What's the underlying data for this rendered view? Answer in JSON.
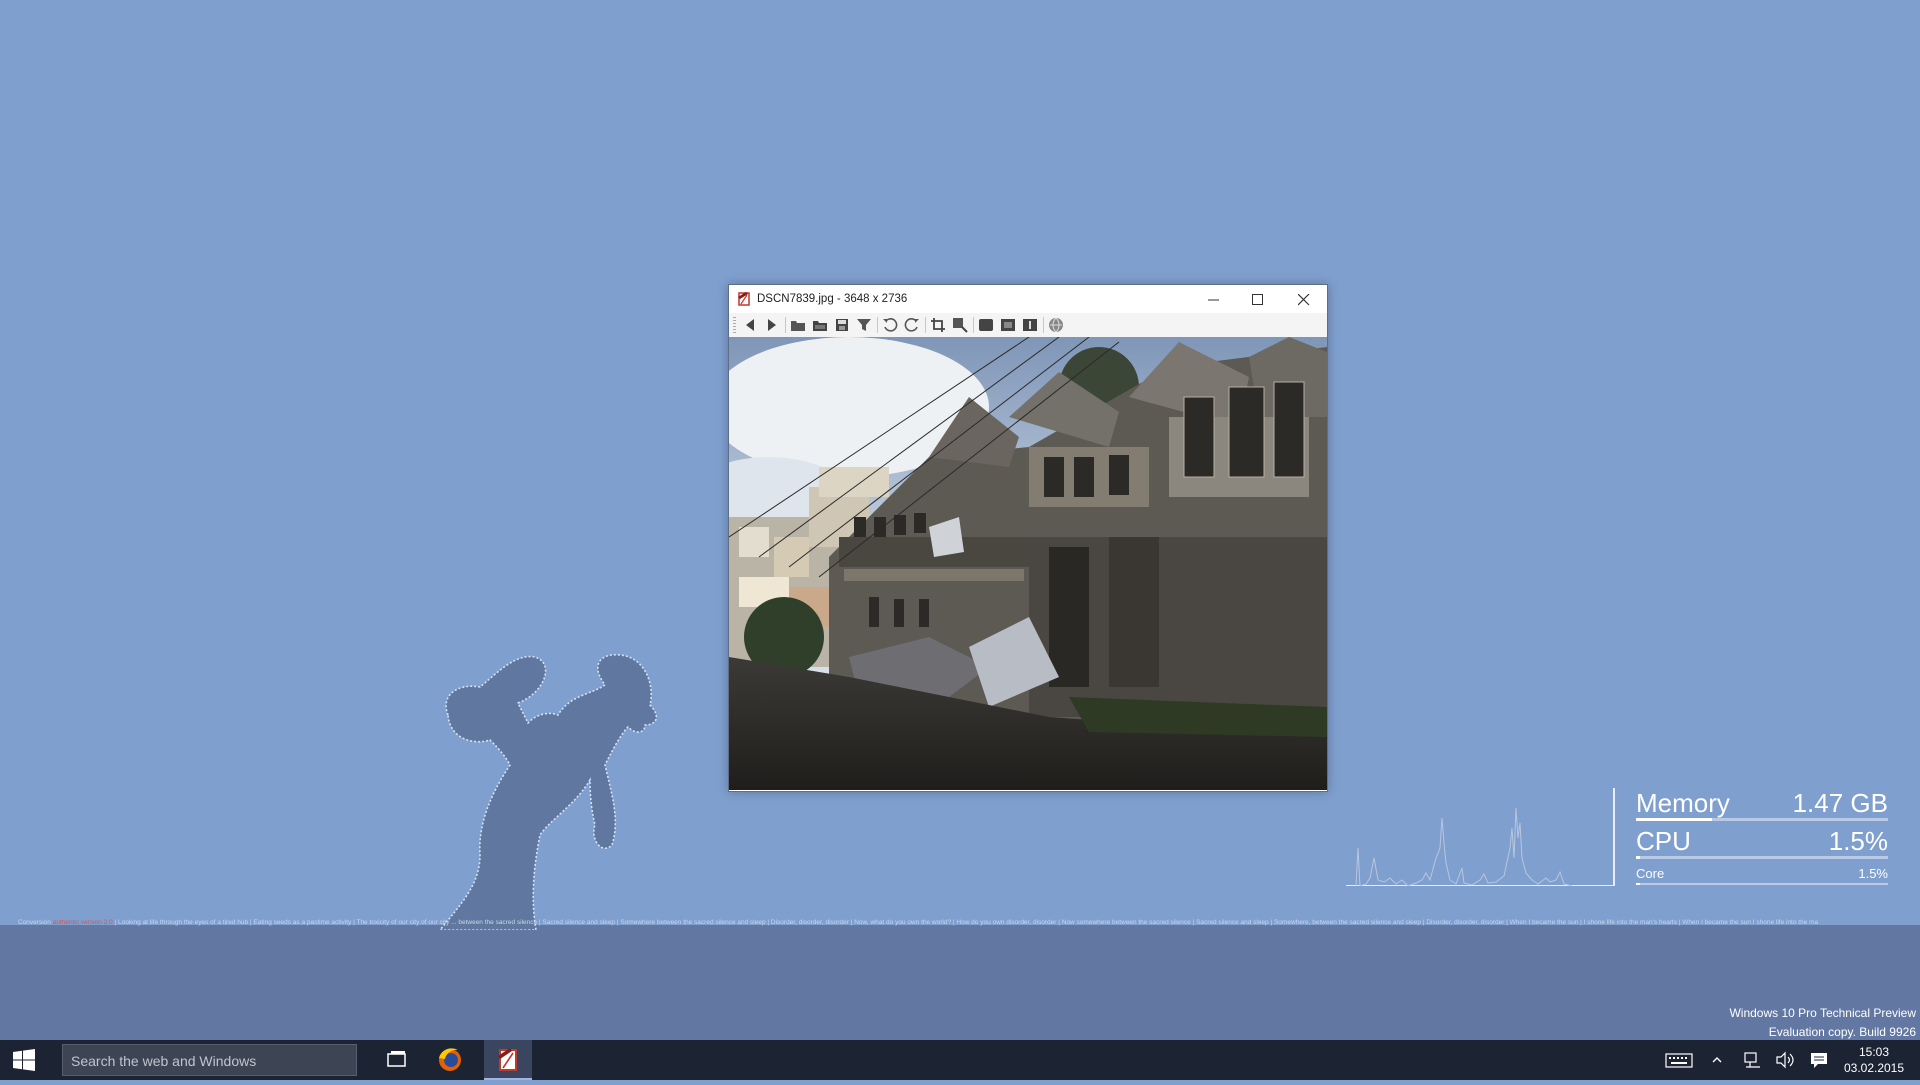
{
  "colors": {
    "desktop": "#7f9fcf",
    "band": "#6277a1",
    "taskbar": "#1c2433",
    "accent_red": "#d9534f"
  },
  "ticker": {
    "prefix": "Conversion",
    "highlight": "authentic version 2.0",
    "text": "| Looking at life through the eyes of a tired hub | Eating seeds as a pastime activity | The toxicity of our city of our city ... between the sacred silence | Sacred silence and sleep | Somewhere between the sacred silence and sleep | Disorder, disorder, disorder | Now, what do you own the world? | How do you own disorder, disorder | Now somewhere between the sacred silence | Sacred silence and sleep | Somewhere, between the sacred silence and sleep | Disorder, disorder, disorder | When I became the sun | I shone life into the man's hearts | When I became the sun I shone life into the ma"
  },
  "viewer": {
    "filename": "DSCN7839.jpg",
    "dimensions": "- 3648 x 2736",
    "toolbar_icons": [
      "back-icon",
      "forward-icon",
      "open-folder-icon",
      "open-icon",
      "save-icon",
      "filter-icon",
      "rotate-left-icon",
      "rotate-right-icon",
      "crop-icon",
      "zoom-icon",
      "fullscreen-icon",
      "fit-icon",
      "info-icon",
      "globe-icon"
    ]
  },
  "meters": {
    "memory_label": "Memory",
    "memory_value": "1.47 GB",
    "memory_fraction": 0.3,
    "cpu_label": "CPU",
    "cpu_value": "1.5%",
    "cpu_fraction": 0.015,
    "core_label": "Core",
    "core_value": "1.5%",
    "core_fraction": 0.015
  },
  "watermark": {
    "line1": "Windows 10 Pro Technical Preview",
    "line2": "Evaluation copy. Build 9926"
  },
  "taskbar": {
    "search_placeholder": "Search the web and Windows",
    "apps": [
      "task-view-icon",
      "firefox-icon",
      "irfanview-icon"
    ],
    "time": "15:03",
    "date": "03.02.2015"
  }
}
